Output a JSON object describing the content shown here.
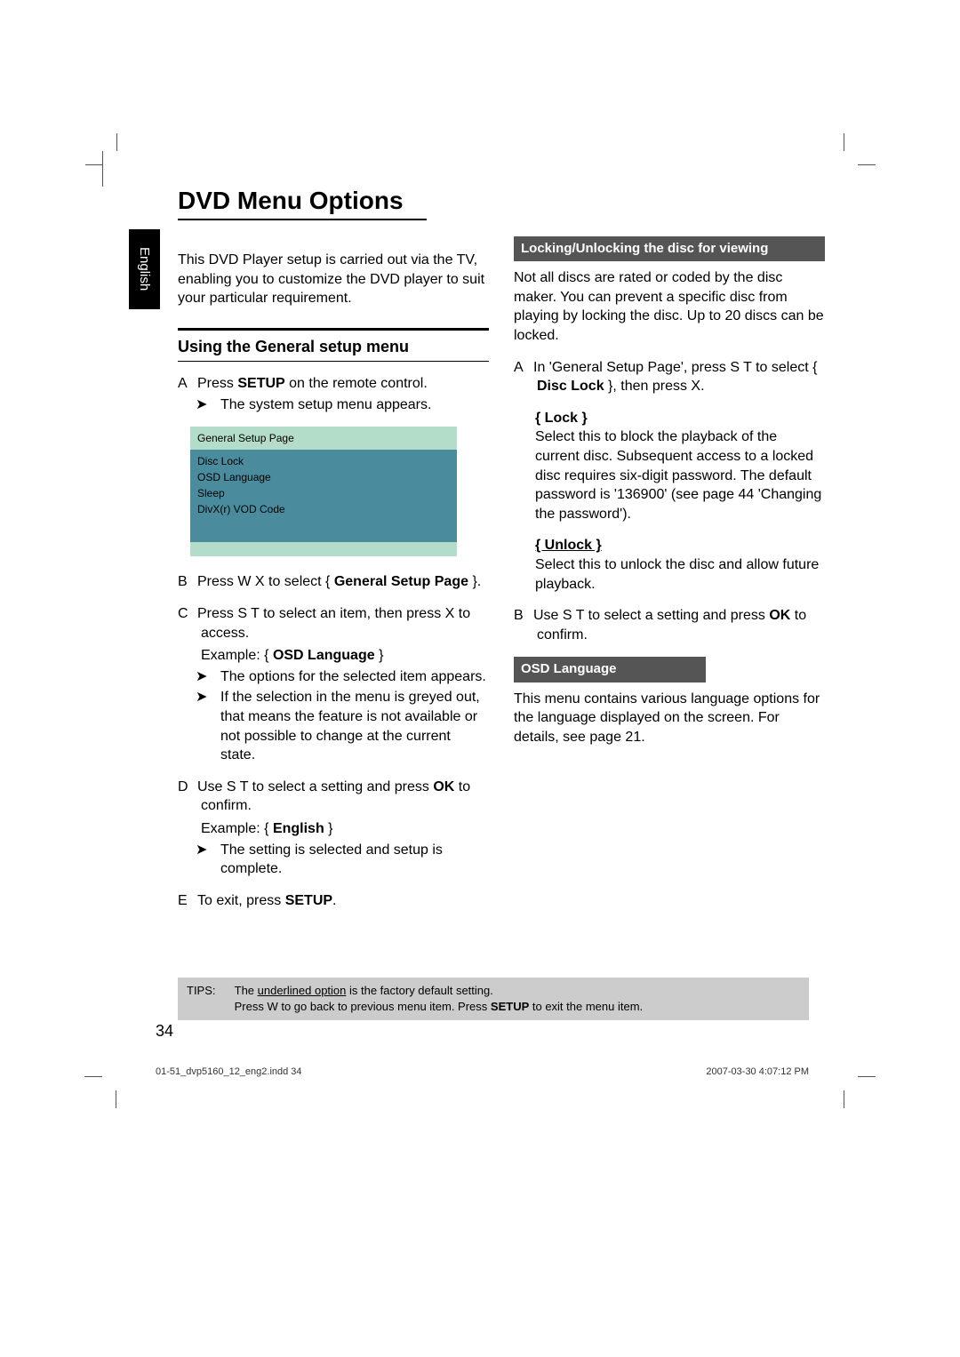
{
  "side_tab": "English",
  "title": "DVD Menu Options",
  "intro": "This DVD Player setup is carried out via the TV, enabling you to customize the DVD player to suit your particular requirement.",
  "section1_heading": "Using the General setup menu",
  "steps": {
    "A": {
      "marker": "A",
      "text_prefix": "Press ",
      "text_bold": "SETUP",
      "text_suffix": " on the remote control.",
      "sub1": "The system setup menu appears."
    },
    "B": {
      "marker": "B",
      "text_prefix": "Press W X to select { ",
      "bold": "General Setup Page",
      "text_suffix": " }."
    },
    "C": {
      "marker": "C",
      "line1": "Press S  T to select an item, then press X to access.",
      "example_label": "Example: { ",
      "example_bold": "OSD Language",
      "example_suffix": " }",
      "sub1": "The options for the selected item appears.",
      "sub2": "If the selection in the menu is greyed out, that means the feature is not available or not possible to change at the current state."
    },
    "D": {
      "marker": "D",
      "line1_prefix": "Use S  T to select a setting and press ",
      "line1_bold": "OK",
      "line1_suffix": " to confirm.",
      "example_label": "Example: { ",
      "example_bold": "English",
      "example_suffix": " }",
      "sub1": "The setting is selected and setup is complete."
    },
    "E": {
      "marker": "E",
      "text_prefix": "To exit, press ",
      "text_bold": "SETUP",
      "text_suffix": "."
    }
  },
  "osd": {
    "header": "General Setup Page",
    "items": [
      "Disc Lock",
      "OSD Language",
      "Sleep",
      "DivX(r) VOD Code"
    ]
  },
  "right": {
    "subhead1": "Locking/Unlocking the disc for viewing",
    "para1": "Not all discs are rated or coded by the disc maker. You can prevent a specific disc from playing by locking the disc. Up to 20 discs can be locked.",
    "stepA_prefix": "In 'General Setup Page', press S T to select { ",
    "stepA_bold": "Disc Lock",
    "stepA_suffix": " }, then press X.",
    "lock_label": "{ Lock }",
    "lock_text": "Select this to block the playback of the current disc. Subsequent access to a locked disc requires six-digit password. The default password is '136900' (see page 44 'Changing the password').",
    "unlock_label": "{ Unlock }",
    "unlock_text": "Select this to unlock the disc and allow future playback.",
    "stepB_marker": "B",
    "stepB_prefix": "Use S  T to select a setting and press ",
    "stepB_bold": "OK",
    "stepB_suffix": " to confirm.",
    "subhead2": "OSD Language",
    "para2": "This menu contains various language options for the language displayed on the screen. For details, see page 21."
  },
  "tips": {
    "label": "TIPS:",
    "line1_prefix": "The ",
    "line1_underline": "underlined option",
    "line1_suffix": " is the factory default setting.",
    "line2_prefix": "Press W to go back to previous menu item. Press ",
    "line2_bold": "SETUP",
    "line2_suffix": " to exit the menu item."
  },
  "page_number": "34",
  "footer_left": "01-51_dvp5160_12_eng2.indd   34",
  "footer_right": "2007-03-30   4:07:12 PM"
}
